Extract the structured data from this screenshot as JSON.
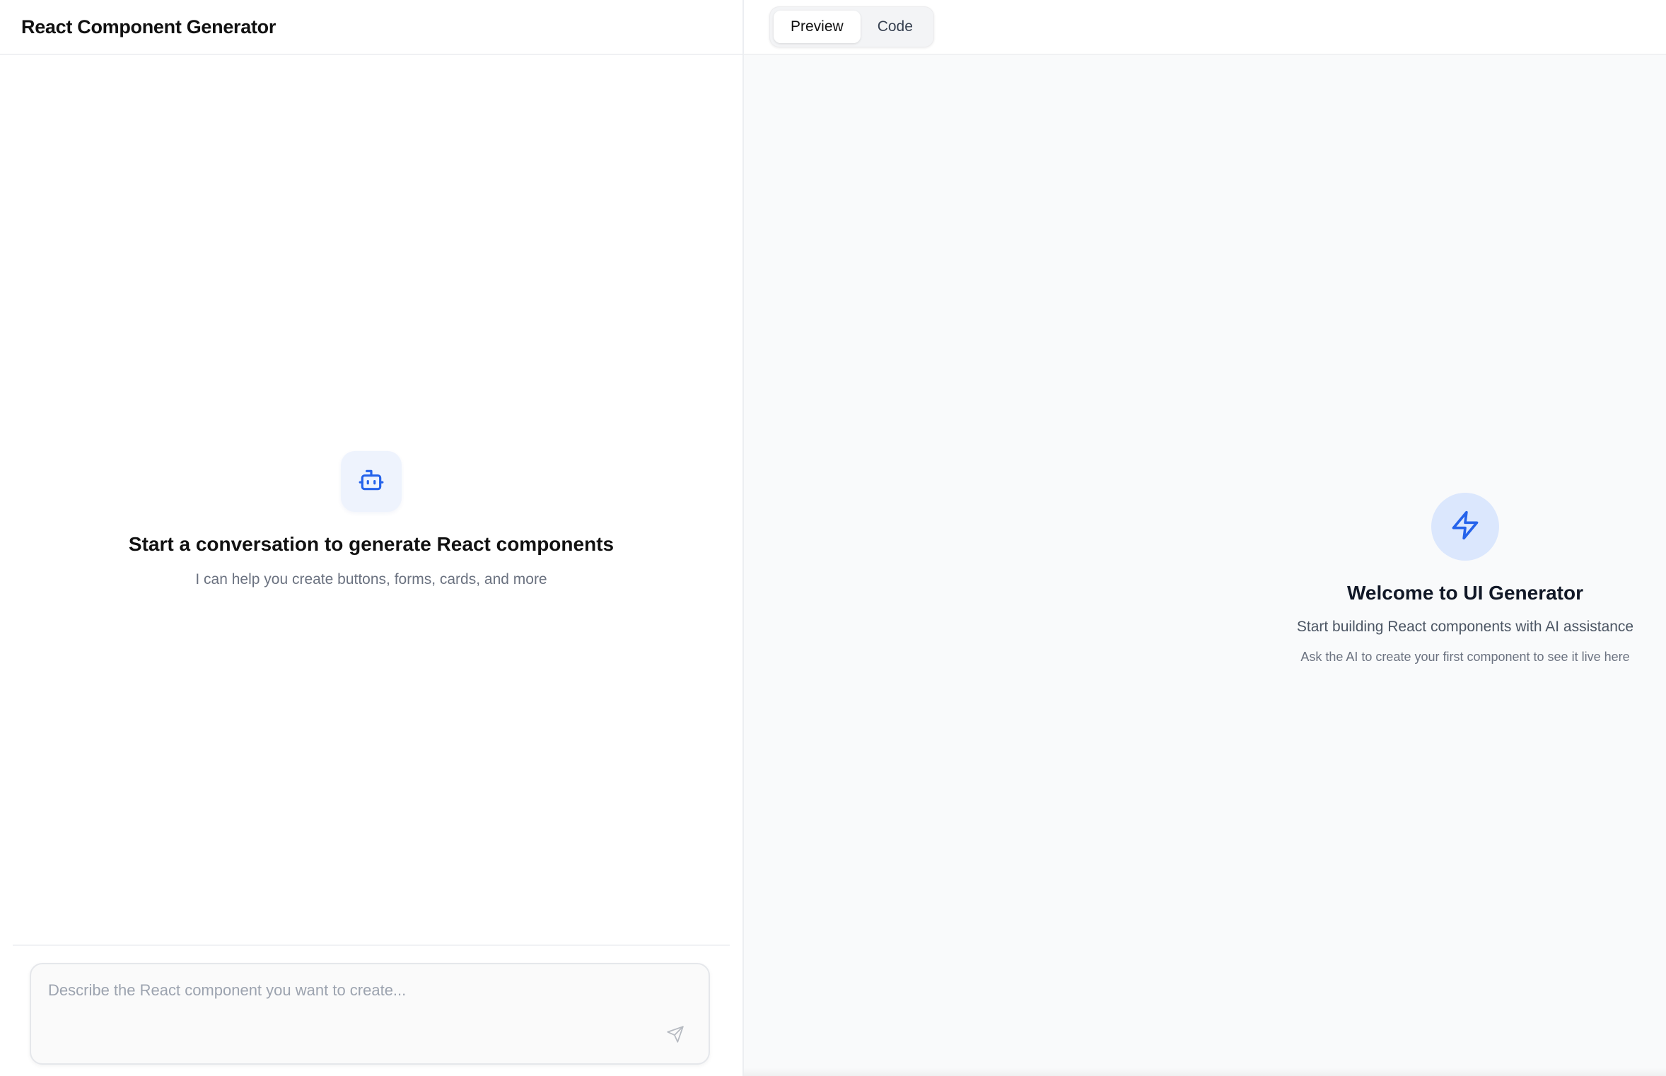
{
  "app": {
    "title": "React Component Generator"
  },
  "chat": {
    "empty_title": "Start a conversation to generate React components",
    "empty_subtitle": "I can help you create buttons, forms, cards, and more",
    "bot_icon": "bot-icon",
    "input_placeholder": "Describe the React component you want to create...",
    "input_value": "",
    "send_icon": "send-icon"
  },
  "preview": {
    "tabs": [
      {
        "label": "Preview",
        "active": true
      },
      {
        "label": "Code",
        "active": false
      }
    ],
    "welcome_icon": "lightning-bolt-icon",
    "welcome_title": "Welcome to UI Generator",
    "welcome_subtitle": "Start building React components with AI assistance",
    "welcome_hint": "Ask the AI to create your first component to see it live here"
  },
  "colors": {
    "accent": "#2563eb",
    "accent_soft": "#dbe7fd",
    "tile_bg": "#eef3fd",
    "preview_bg": "#f9fafb"
  }
}
